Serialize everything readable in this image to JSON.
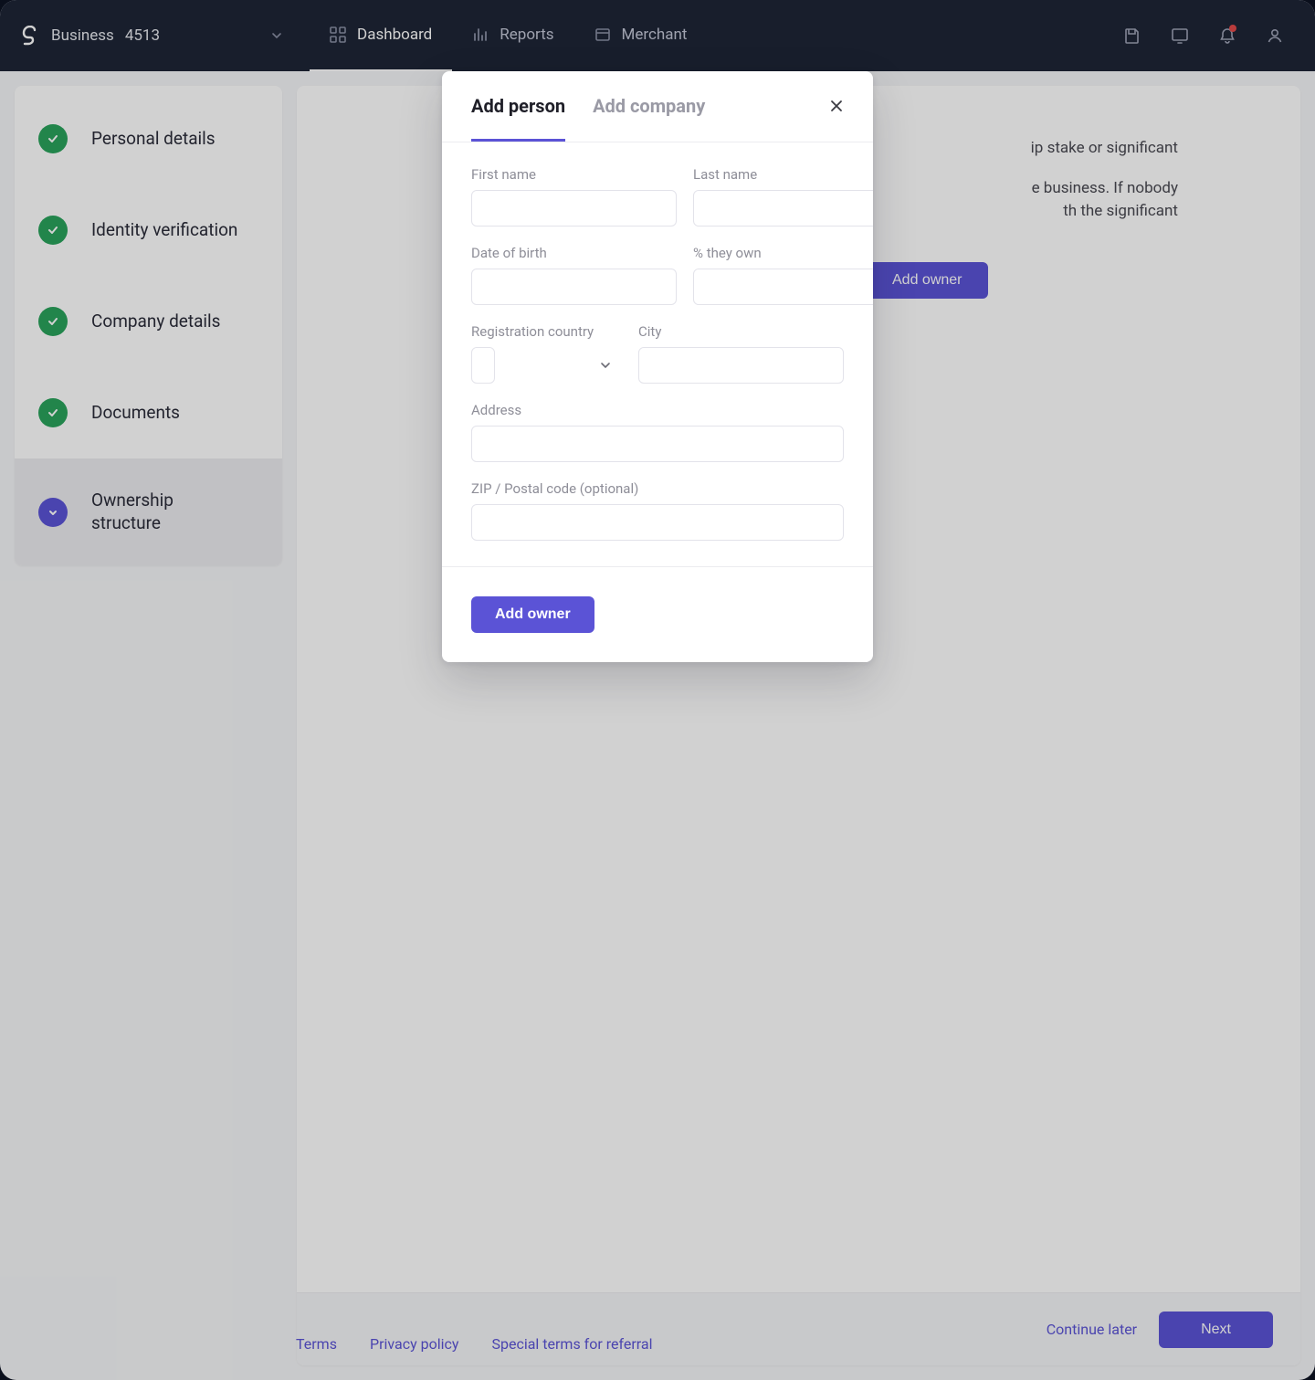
{
  "header": {
    "workspace_label": "Business",
    "workspace_id": "4513",
    "nav": {
      "dashboard": "Dashboard",
      "reports": "Reports",
      "merchant": "Merchant"
    }
  },
  "sidebar": {
    "items": [
      {
        "label": "Personal details",
        "state": "done"
      },
      {
        "label": "Identity verification",
        "state": "done"
      },
      {
        "label": "Company details",
        "state": "done"
      },
      {
        "label": "Documents",
        "state": "done"
      },
      {
        "label": "Ownership structure",
        "state": "active"
      }
    ]
  },
  "main": {
    "paragraph1_fragment": "ip stake or significant",
    "paragraph2_fragment_a": "e business. If nobody",
    "paragraph2_fragment_b": "th the significant",
    "add_owner_btn": "Add owner",
    "continue_later": "Continue later",
    "next": "Next"
  },
  "footer": {
    "terms": "Terms",
    "privacy": "Privacy policy",
    "referral": "Special terms for referral"
  },
  "modal": {
    "tabs": {
      "person": "Add person",
      "company": "Add company"
    },
    "fields": {
      "first_name": "First name",
      "last_name": "Last name",
      "dob": "Date of birth",
      "pct_own": "% they own",
      "reg_country": "Registration country",
      "city": "City",
      "address": "Address",
      "zip": "ZIP / Postal code (optional)"
    },
    "values": {
      "first_name": "",
      "last_name": "",
      "dob": "",
      "pct_own": "",
      "reg_country": "",
      "city": "",
      "address": "",
      "zip": ""
    },
    "submit": "Add owner"
  },
  "colors": {
    "primary": "#5b53d6",
    "success": "#2aa35c",
    "navbar": "#1e2536"
  }
}
